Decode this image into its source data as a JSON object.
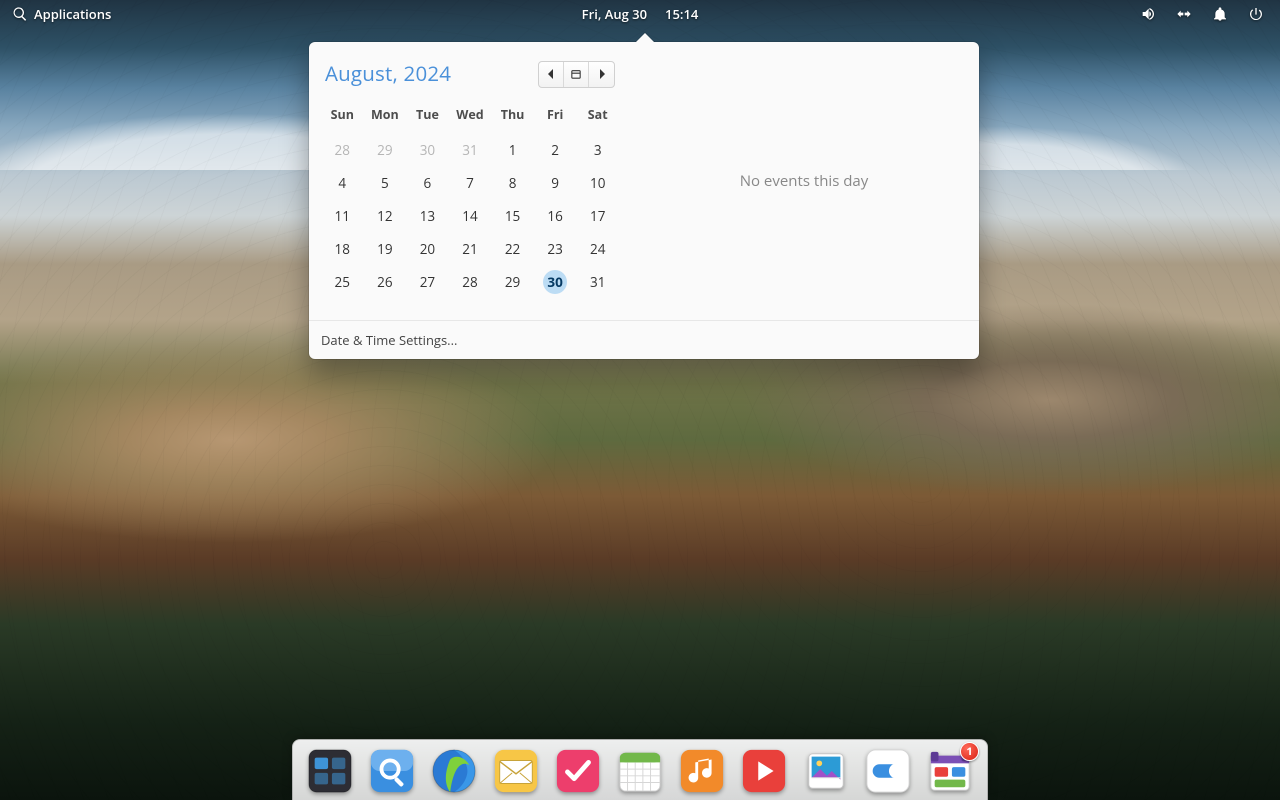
{
  "topbar": {
    "applications_label": "Applications",
    "date_label": "Fri, Aug 30",
    "time_label": "15:14"
  },
  "calendar": {
    "month_label": "August, 2024",
    "weekdays": [
      "Sun",
      "Mon",
      "Tue",
      "Wed",
      "Thu",
      "Fri",
      "Sat"
    ],
    "weeks": [
      [
        {
          "d": "28",
          "dim": true
        },
        {
          "d": "29",
          "dim": true
        },
        {
          "d": "30",
          "dim": true
        },
        {
          "d": "31",
          "dim": true
        },
        {
          "d": "1"
        },
        {
          "d": "2"
        },
        {
          "d": "3"
        }
      ],
      [
        {
          "d": "4"
        },
        {
          "d": "5"
        },
        {
          "d": "6"
        },
        {
          "d": "7"
        },
        {
          "d": "8"
        },
        {
          "d": "9"
        },
        {
          "d": "10"
        }
      ],
      [
        {
          "d": "11"
        },
        {
          "d": "12"
        },
        {
          "d": "13"
        },
        {
          "d": "14"
        },
        {
          "d": "15"
        },
        {
          "d": "16"
        },
        {
          "d": "17"
        }
      ],
      [
        {
          "d": "18"
        },
        {
          "d": "19"
        },
        {
          "d": "20"
        },
        {
          "d": "21"
        },
        {
          "d": "22"
        },
        {
          "d": "23"
        },
        {
          "d": "24"
        }
      ],
      [
        {
          "d": "25"
        },
        {
          "d": "26"
        },
        {
          "d": "27"
        },
        {
          "d": "28"
        },
        {
          "d": "29"
        },
        {
          "d": "30",
          "today": true
        },
        {
          "d": "31"
        }
      ]
    ],
    "events_empty_label": "No events this day",
    "footer_label": "Date & Time Settings..."
  },
  "dock": {
    "items": [
      {
        "name": "multitasking-view"
      },
      {
        "name": "files"
      },
      {
        "name": "web-browser"
      },
      {
        "name": "mail"
      },
      {
        "name": "tasks"
      },
      {
        "name": "calendar-app"
      },
      {
        "name": "music"
      },
      {
        "name": "videos"
      },
      {
        "name": "photos"
      },
      {
        "name": "system-settings"
      },
      {
        "name": "appcenter"
      }
    ],
    "appcenter_badge": "1"
  }
}
